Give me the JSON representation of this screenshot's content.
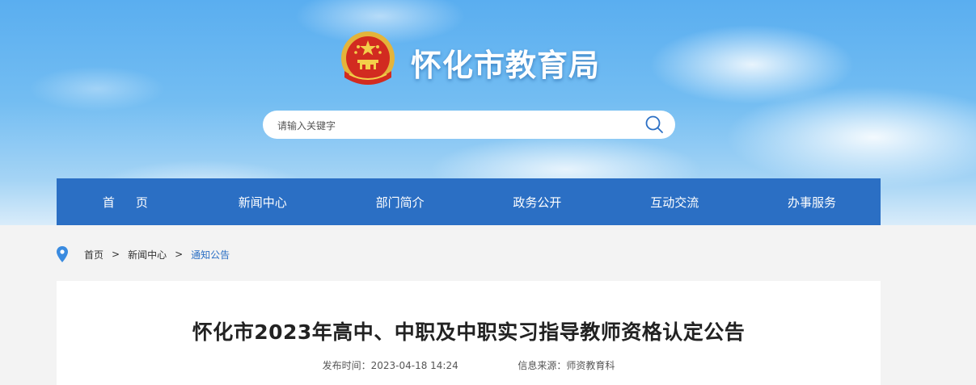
{
  "header": {
    "site_title": "怀化市教育局",
    "emblem_icon": "national-emblem-icon",
    "search": {
      "placeholder": "请输入关键字",
      "icon": "search-icon"
    }
  },
  "nav": {
    "items": [
      {
        "label": "首页"
      },
      {
        "label": "新闻中心"
      },
      {
        "label": "部门简介"
      },
      {
        "label": "政务公开"
      },
      {
        "label": "互动交流"
      },
      {
        "label": "办事服务"
      }
    ]
  },
  "breadcrumb": {
    "icon": "location-pin-icon",
    "items": [
      "首页",
      "新闻中心",
      "通知公告"
    ],
    "separator": ">"
  },
  "article": {
    "title": "怀化市2023年高中、中职及中职实习指导教师资格认定公告",
    "publish_time_label": "发布时间：",
    "publish_time": "2023-04-18 14:24",
    "source_label": "信息来源：",
    "source": "师资教育科"
  },
  "colors": {
    "nav_bg": "#2b6fc4",
    "breadcrumb_current": "#2b6fc4",
    "page_bg": "#f3f3f3"
  }
}
